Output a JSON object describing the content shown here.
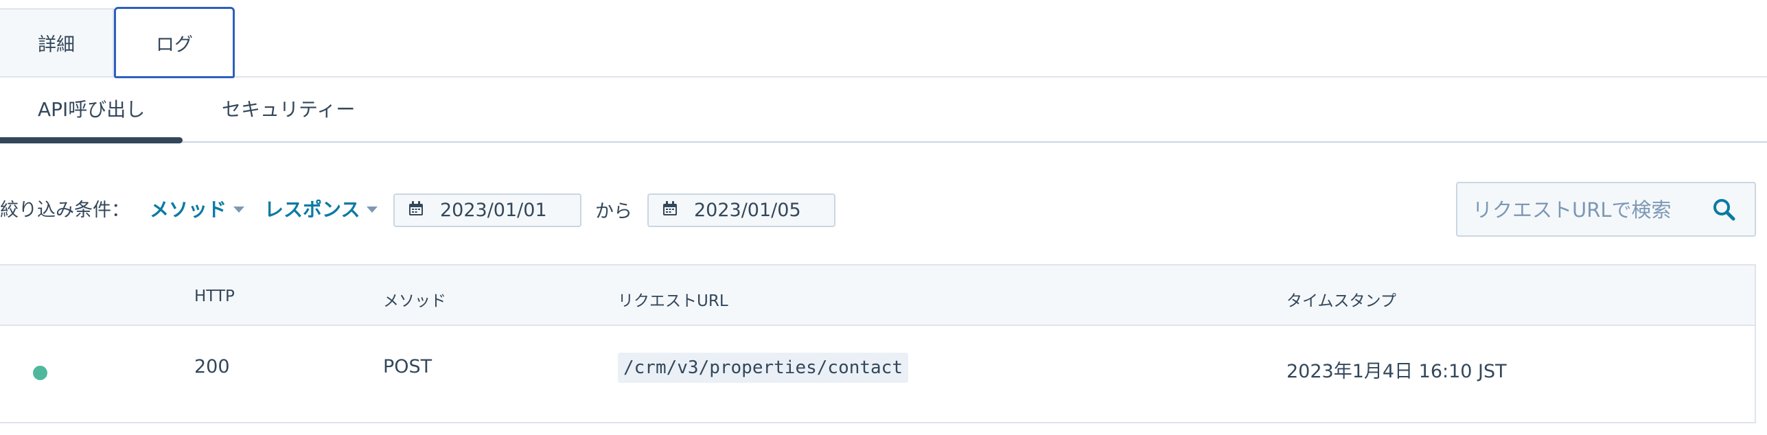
{
  "top_tabs": {
    "details": "詳細",
    "log": "ログ"
  },
  "sub_tabs": {
    "api_calls": "API呼び出し",
    "security": "セキュリティー"
  },
  "filters": {
    "label": "絞り込み条件：",
    "method": "メソッド",
    "response": "レスポンス",
    "date_from": "2023/01/01",
    "separator": "から",
    "date_to": "2023/01/05",
    "search_placeholder": "リクエストURLで検索"
  },
  "table": {
    "columns": [
      "HTTP",
      "メソッド",
      "リクエストURL",
      "タイムスタンプ"
    ],
    "rows": [
      {
        "status_color": "#4fb89c",
        "http": "200",
        "method": "POST",
        "url": "/crm/v3/properties/contact",
        "timestamp": "2023年1月4日 16:10 JST"
      }
    ]
  },
  "colors": {
    "accent": "#0b7aa3",
    "active_tab_border": "#2d5ebf",
    "success": "#4fb89c",
    "text": "#33475b"
  }
}
